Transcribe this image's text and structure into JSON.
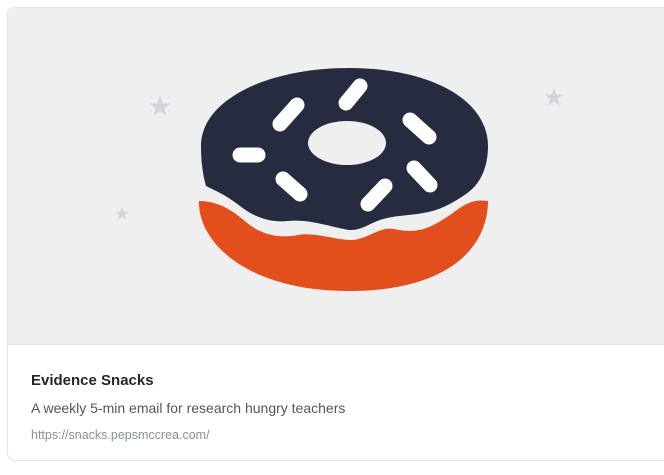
{
  "link_card": {
    "title": "Evidence Snacks",
    "description": "A weekly 5-min email for research hungry teachers",
    "url": "https://snacks.pepsmccrea.com/"
  },
  "colors": {
    "hero_background": "#efeff0",
    "donut_icing": "#272b40",
    "donut_base": "#e24f1c",
    "sprinkles": "#ffffff",
    "stars": "#d2d4d9"
  },
  "icons": [
    "donut-icon",
    "star-icon"
  ]
}
